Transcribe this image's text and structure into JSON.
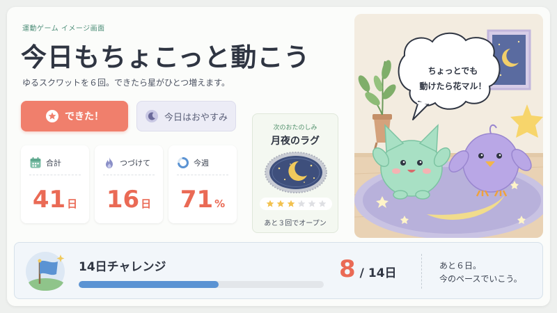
{
  "header": {
    "kicker": "運動ゲーム イメージ画面",
    "title": "今日もちょこっと動こう",
    "description": "ゆるスクワットを６回。できたら星がひとつ増えます。"
  },
  "actions": {
    "done_label": "できた！",
    "rest_label": "今日はおやすみ"
  },
  "stats": [
    {
      "icon": "calendar-icon",
      "label": "合計",
      "value": "41",
      "unit": "日"
    },
    {
      "icon": "flame-icon",
      "label": "つづけて",
      "value": "16",
      "unit": "日"
    },
    {
      "icon": "progress-ring-icon",
      "label": "今週",
      "value": "71",
      "unit": "%"
    }
  ],
  "weekly_percent": 71,
  "reward": {
    "kicker": "次のおたのしみ",
    "title": "月夜のラグ",
    "stars_filled": 3,
    "stars_total": 6,
    "caption": "あと３回でオープン"
  },
  "scene": {
    "bubble_line1": "ちょっとでも",
    "bubble_line2": "動けたら花マル！"
  },
  "challenge": {
    "title": "14日チャレンジ",
    "current": "8",
    "separator": "/",
    "total": "14日",
    "progress": 0.57,
    "note_line1": "あと６日。",
    "note_line2": "今のペースでいこう。"
  },
  "colors": {
    "accent": "#f07f6c",
    "value": "#ea6a55",
    "progress": "#5b93d3",
    "rest_button": "#ececf6"
  }
}
